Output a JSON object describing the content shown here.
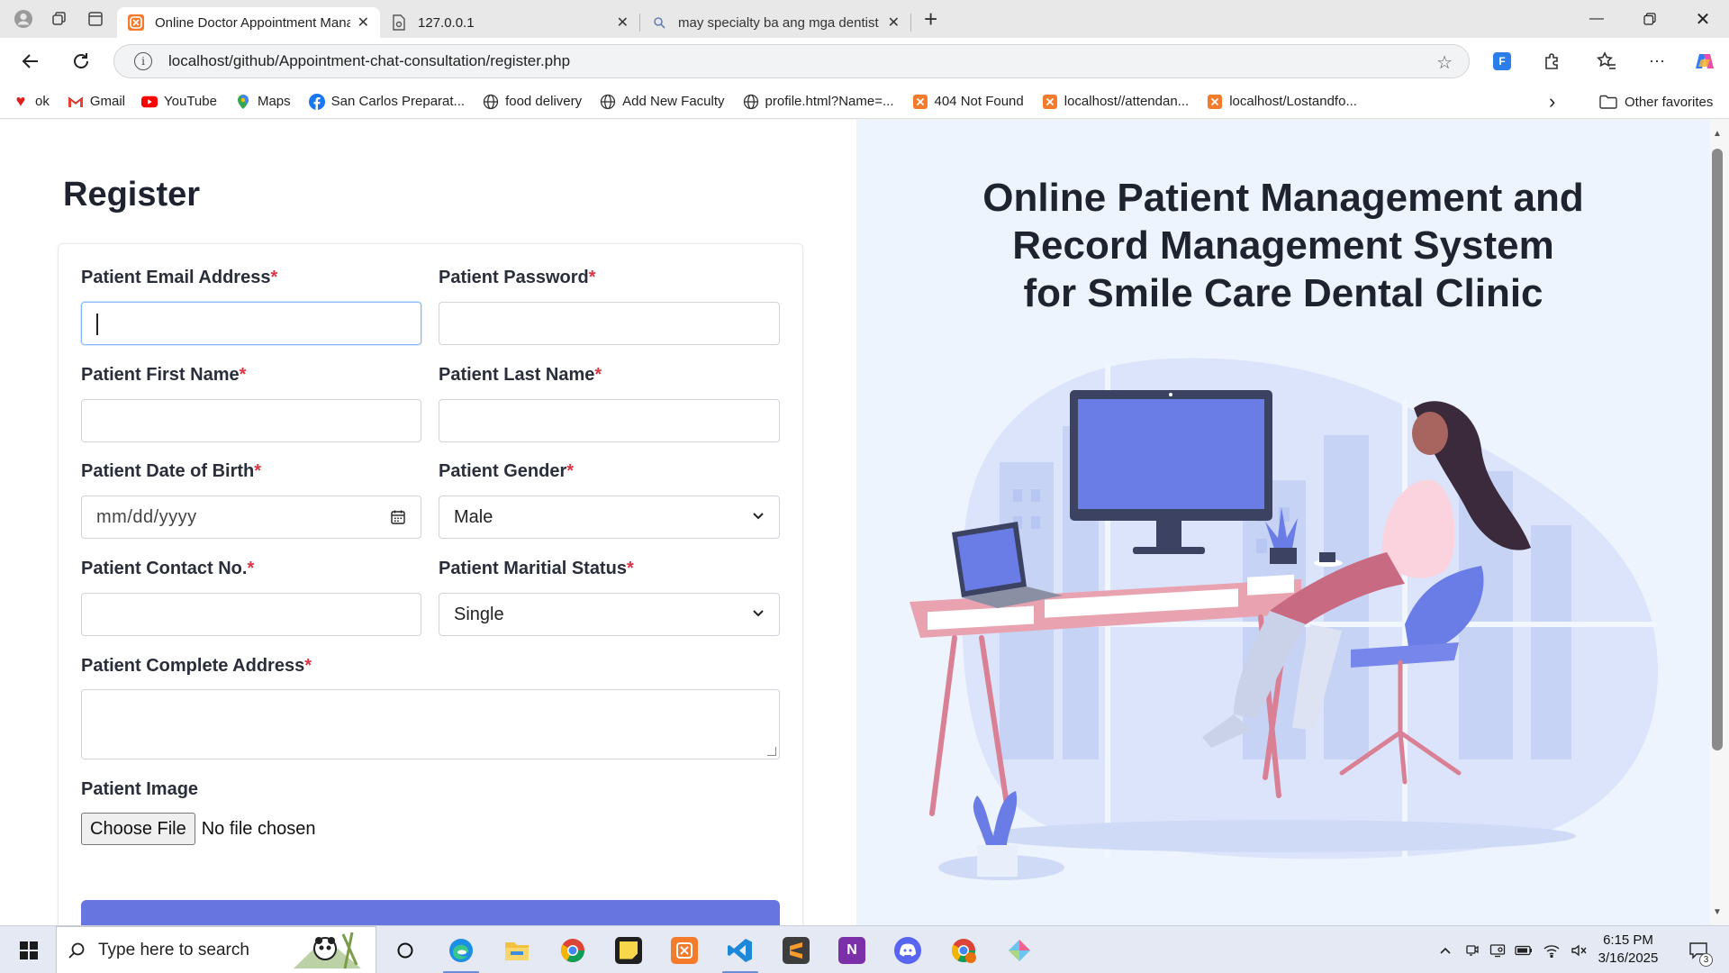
{
  "browser": {
    "tabs": [
      {
        "title": "Online Doctor Appointment Mana",
        "active": true
      },
      {
        "title": "127.0.0.1",
        "active": false
      },
      {
        "title": "may specialty ba ang mga dentist",
        "active": false
      }
    ],
    "url": "localhost/github/Appointment-chat-consultation/register.php",
    "bookmarks": [
      {
        "label": "ok",
        "icon": "heart-icon"
      },
      {
        "label": "Gmail",
        "icon": "gmail-icon"
      },
      {
        "label": "YouTube",
        "icon": "youtube-icon"
      },
      {
        "label": "Maps",
        "icon": "maps-pin-icon"
      },
      {
        "label": "San Carlos Preparat...",
        "icon": "facebook-icon"
      },
      {
        "label": "food delivery",
        "icon": "globe-icon"
      },
      {
        "label": "Add New Faculty",
        "icon": "globe-icon"
      },
      {
        "label": "profile.html?Name=...",
        "icon": "globe-icon"
      },
      {
        "label": "404 Not Found",
        "icon": "xampp-icon"
      },
      {
        "label": "localhost//attendan...",
        "icon": "xampp-icon"
      },
      {
        "label": "localhost/Lostandfo...",
        "icon": "xampp-icon"
      }
    ],
    "other_favorites": "Other favorites"
  },
  "form": {
    "title": "Register",
    "required_mark": "*",
    "email_label": "Patient Email Address",
    "password_label": "Patient Password",
    "first_name_label": "Patient First Name",
    "last_name_label": "Patient Last Name",
    "dob_label": "Patient Date of Birth",
    "dob_placeholder": "mm/dd/yyyy",
    "gender_label": "Patient Gender",
    "gender_value": "Male",
    "contact_label": "Patient Contact No.",
    "marital_label": "Patient Maritial Status",
    "marital_value": "Single",
    "address_label": "Patient Complete Address",
    "image_label": "Patient Image",
    "file_button": "Choose File",
    "file_status": "No file chosen"
  },
  "hero": {
    "line1": "Online Patient Management and",
    "line2": "Record Management System",
    "line3": "for Smile Care Dental Clinic"
  },
  "taskbar": {
    "search_placeholder": "Type here to search",
    "time": "6:15 PM",
    "date": "3/16/2025",
    "notification_count": "3"
  },
  "colors": {
    "accent": "#6675e0",
    "required": "#dc3545",
    "hero_bg": "#eef4fe"
  }
}
